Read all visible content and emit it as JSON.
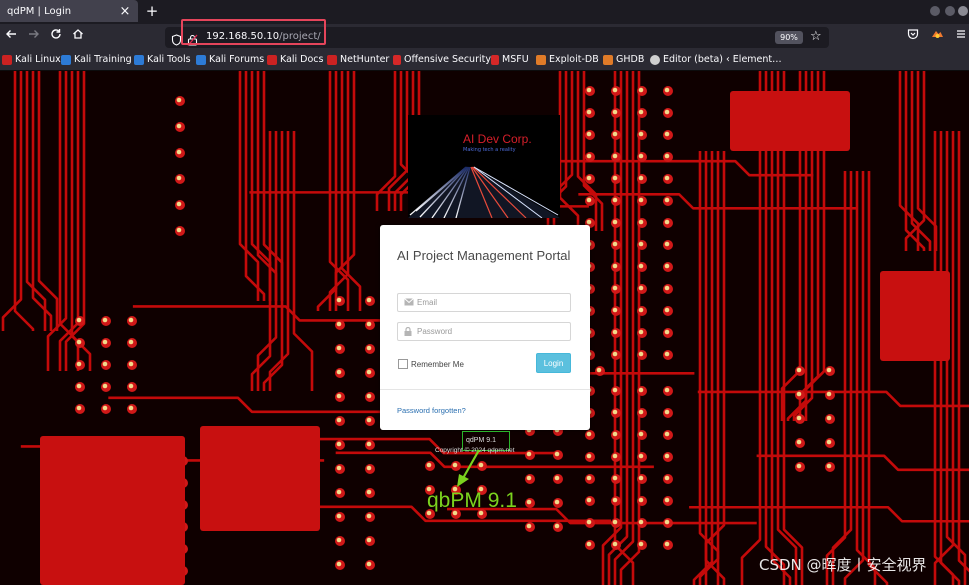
{
  "browser": {
    "tab_title": "qdPM | Login",
    "tab_close": "×",
    "new_tab": "+",
    "url_host": "192.168.50.10",
    "url_path": "/project/",
    "zoom": "90%",
    "bookmarks": [
      {
        "label": "Kali Linux",
        "icon": "kali-dragon-icon",
        "color": "#cc2222"
      },
      {
        "label": "Kali Training",
        "icon": "kali-icon",
        "color": "#2d7bd6"
      },
      {
        "label": "Kali Tools",
        "icon": "kali-icon",
        "color": "#2d7bd6"
      },
      {
        "label": "Kali Forums",
        "icon": "kali-icon",
        "color": "#2d7bd6"
      },
      {
        "label": "Kali Docs",
        "icon": "kali-docs-icon",
        "color": "#cc2222"
      },
      {
        "label": "NetHunter",
        "icon": "kali-dragon-icon",
        "color": "#cc2222"
      },
      {
        "label": "Offensive Security",
        "icon": "offsec-icon",
        "color": "#d62828"
      },
      {
        "label": "MSFU",
        "icon": "offsec-icon",
        "color": "#d62828"
      },
      {
        "label": "Exploit-DB",
        "icon": "exploitdb-icon",
        "color": "#e07b28"
      },
      {
        "label": "GHDB",
        "icon": "exploitdb-icon",
        "color": "#e07b28"
      },
      {
        "label": "Editor (beta) ‹ Element…",
        "icon": "wordpress-icon",
        "color": "#cfcfcf"
      }
    ]
  },
  "page": {
    "logo_title": "AI Dev Corp.",
    "logo_tagline": "Making tech a reality",
    "login_title": "AI Project Management Portal",
    "email_placeholder": "Email",
    "password_placeholder": "Password",
    "remember_label": "Remember Me",
    "login_button": "Login",
    "forgot_link": "Password forgotten?",
    "version": "qdPM 9.1",
    "copyright": "Copyright © 2024 qdpm.net"
  },
  "annotation": {
    "label": "qbPM 9.1"
  },
  "watermark": "CSDN @晖度丨安全视界",
  "colors": {
    "highlight_red": "#e5455b",
    "annotation_green": "#7bd31e",
    "login_blue": "#5bc0de",
    "pcb_red": "#c40a0a"
  }
}
